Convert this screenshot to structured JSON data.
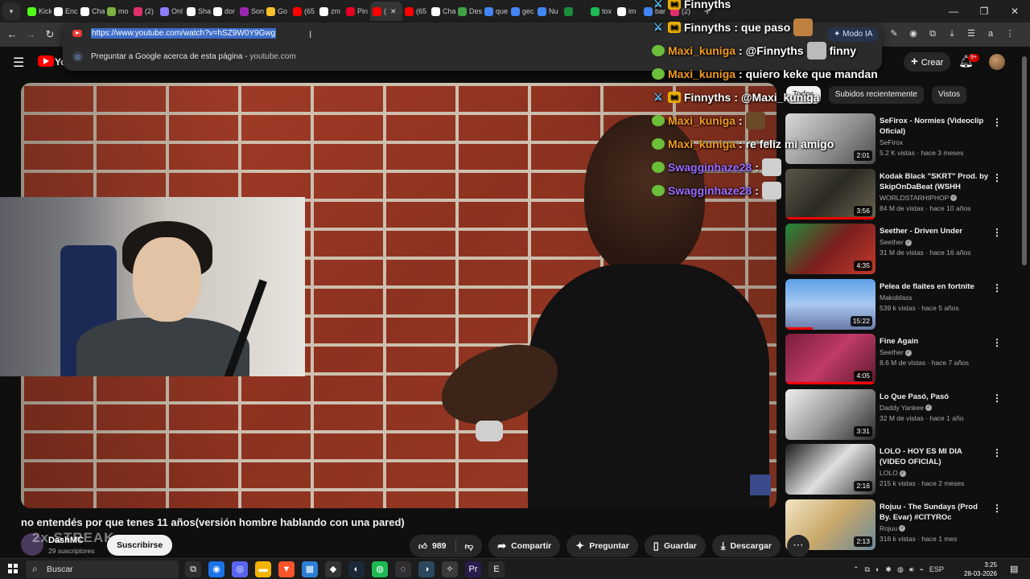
{
  "browser": {
    "tabs": [
      {
        "label": "Kick",
        "color": "#53fc18",
        "active": false
      },
      {
        "label": "Enc",
        "color": "#ffffff",
        "active": false
      },
      {
        "label": "Cha",
        "color": "#ffffff",
        "active": false
      },
      {
        "label": "mo",
        "color": "#7cb342",
        "active": false
      },
      {
        "label": "(2)",
        "color": "#e1306c",
        "active": false
      },
      {
        "label": "Onl",
        "color": "#8c7cff",
        "active": false
      },
      {
        "label": "Sha",
        "color": "#ffffff",
        "active": false
      },
      {
        "label": "dor",
        "color": "#ffffff",
        "active": false
      },
      {
        "label": "Son",
        "color": "#9c27b0",
        "active": false
      },
      {
        "label": "Go",
        "color": "#fbc02d",
        "active": false
      },
      {
        "label": "(65",
        "color": "#ff0000",
        "active": false
      },
      {
        "label": "zm",
        "color": "#ffffff",
        "active": false
      },
      {
        "label": "Pin",
        "color": "#e60023",
        "active": false
      },
      {
        "label": "(",
        "color": "#ff0000",
        "active": true
      },
      {
        "label": "(65",
        "color": "#ff0000",
        "active": false
      },
      {
        "label": "Cha",
        "color": "#ffffff",
        "active": false
      },
      {
        "label": "Des",
        "color": "#43a047",
        "active": false
      },
      {
        "label": "que",
        "color": "#4285f4",
        "active": false
      },
      {
        "label": "gec",
        "color": "#4285f4",
        "active": false
      },
      {
        "label": "Nu",
        "color": "#4285f4",
        "active": false
      },
      {
        "label": "",
        "color": "#1e8e3e",
        "active": false
      },
      {
        "label": "tox",
        "color": "#1db954",
        "active": false
      },
      {
        "label": "im",
        "color": "#ffffff",
        "active": false
      },
      {
        "label": "bar",
        "color": "#4285f4",
        "active": false
      },
      {
        "label": "(2)",
        "color": "#e1306c",
        "active": false
      }
    ],
    "new_tab": "+",
    "window_controls": {
      "minimize": "—",
      "restore": "❐",
      "close": "✕"
    },
    "nav": {
      "back": "←",
      "forward": "→",
      "reload": "↻"
    },
    "url": "https://www.youtube.com/watch?v=hSZ9W0Y9Gwg",
    "suggestion": {
      "text": "Preguntar a Google acerca de esta página",
      "separator": " - ",
      "domain": "youtube.com",
      "icon": "google-lens-icon"
    },
    "modo_ia": "Modo IA",
    "extensions": [
      "✎",
      "◉",
      "⧉",
      "⤓",
      "☰",
      "a",
      "⋮"
    ]
  },
  "youtube": {
    "logo_text": "YouTube",
    "create_label": "Crear",
    "notif_count": "9+",
    "chips": [
      {
        "label": "Todos",
        "active": true
      },
      {
        "label": "Subidos recientemente",
        "active": false
      },
      {
        "label": "Vistos",
        "active": false
      }
    ],
    "video": {
      "title": "no entendés por que tenes 11 años(versión hombre hablando con una pared)",
      "channel": "DashMC",
      "subscribers": "29 suscriptores",
      "subscribe_label": "Suscribirse",
      "likes": "989",
      "share_label": "Compartir",
      "ask_label": "Preguntar",
      "save_label": "Guardar",
      "download_label": "Descargar",
      "more": "⋯"
    },
    "recommendations": [
      {
        "title": "SeFirox - Normies (Videoclip Oficial)",
        "channel": "SeFirox",
        "verified": false,
        "meta": "5.2 K vistas · hace 3 meses",
        "duration": "2:01",
        "progress": 0,
        "thumb": "linear-gradient(135deg,#d9d9d9,#8a8a8a 60%,#4a4a4a)"
      },
      {
        "title": "Kodak Black \"SKRT\" Prod. by SkipOnDaBeat (WSHH Exclusi...",
        "channel": "WORLDSTARHIPHOP",
        "verified": true,
        "meta": "84 M de vistas · hace 10 años",
        "duration": "3:56",
        "progress": 1,
        "thumb": "linear-gradient(135deg,#5a5648,#2b2a24 50%,#6b6552)"
      },
      {
        "title": "Seether - Driven Under",
        "channel": "Seether",
        "verified": true,
        "meta": "31 M de vistas · hace 16 años",
        "duration": "4:35",
        "progress": 0,
        "thumb": "linear-gradient(135deg,#1e8c3a,#7a1e1e 50%,#c23b2a)"
      },
      {
        "title": "Pelea de flaites en fortnite",
        "channel": "Makoblass",
        "verified": false,
        "meta": "539 k vistas · hace 5 años",
        "duration": "15:22",
        "progress": 0.3,
        "thumb": "linear-gradient(180deg,#5ea0e8,#a8c8f0 50%,#6a7aa8)"
      },
      {
        "title": "Fine Again",
        "channel": "Seether",
        "verified": true,
        "meta": "8.6 M de vistas · hace 7 años",
        "duration": "4:05",
        "progress": 1,
        "thumb": "linear-gradient(135deg,#7a1e3a,#c03a6a 50%,#5a1a2a)"
      },
      {
        "title": "Lo Que Pasó, Pasó",
        "channel": "Daddy Yankee",
        "verified": true,
        "meta": "32 M de vistas · hace 1 año",
        "duration": "3:31",
        "progress": 0,
        "thumb": "linear-gradient(135deg,#f0f0f0,#9a9a9a 50%,#2a2a2a)"
      },
      {
        "title": "LOLO - HOY ES MI DIA (VIDEO OFICIAL)",
        "channel": "LOLO",
        "verified": true,
        "meta": "215 k vistas · hace 2 meses",
        "duration": "2:16",
        "progress": 0,
        "thumb": "linear-gradient(135deg,#1a1a1a,#e0e0e0 50%,#3a3a3a)"
      },
      {
        "title": "Rojuu - The Sundays (Prod By. Evar) #CITYROc",
        "channel": "Rojuu",
        "verified": true,
        "meta": "316 k vistas · hace 1 mes",
        "duration": "2:13",
        "progress": 0,
        "thumb": "linear-gradient(135deg,#f3e6c4,#c9a86a 50%,#6a8a9a)"
      }
    ]
  },
  "chat": [
    {
      "user": "Finnyths",
      "badge": "sword",
      "class": "u-f",
      "message": "",
      "emote": ""
    },
    {
      "user": "Finnyths",
      "badge": "sword",
      "class": "u-f",
      "message": ": que paso",
      "emote": "#c08040"
    },
    {
      "user": "Maxi_kuniga",
      "badge": "frog",
      "class": "u-m",
      "message": ": @Finnyths",
      "emote": "#bbbbbb",
      "message2": "finny"
    },
    {
      "user": "Maxi_kuniga",
      "badge": "frog",
      "class": "u-m",
      "message": ": quiero keke que mandan",
      "emote": ""
    },
    {
      "user": "Finnyths",
      "badge": "sword",
      "class": "u-f",
      "message": ": @Maxi_kuniga",
      "emote": ""
    },
    {
      "user": "Maxi_kuniga",
      "badge": "frog",
      "class": "u-m",
      "message": ":",
      "emote": "#6b4a2a"
    },
    {
      "user": "Maxi_kuniga",
      "badge": "frog",
      "class": "u-m",
      "message": ": re feliz mi amigo",
      "emote": ""
    },
    {
      "user": "Swagginhaze28",
      "badge": "frog",
      "class": "u-s",
      "message": ":",
      "emote": "#d0d0d0"
    },
    {
      "user": "Swagginhaze28",
      "badge": "frog",
      "class": "u-s",
      "message": ":",
      "emote": "#d0d0d0"
    }
  ],
  "stream_overlay": {
    "streak": "2x STREAK"
  },
  "taskbar": {
    "search_placeholder": "Buscar",
    "apps": [
      {
        "name": "task-view-icon",
        "glyph": "⧉",
        "color": "#2d2d2d"
      },
      {
        "name": "chrome-icon",
        "glyph": "◉",
        "color": "#1a73e8"
      },
      {
        "name": "discord-icon",
        "glyph": "◎",
        "color": "#5865f2"
      },
      {
        "name": "folder-icon",
        "glyph": "▬",
        "color": "#f2b200"
      },
      {
        "name": "brave-icon",
        "glyph": "▼",
        "color": "#fb542b"
      },
      {
        "name": "store-icon",
        "glyph": "▦",
        "color": "#2d7fd6"
      },
      {
        "name": "epic-icon",
        "glyph": "◆",
        "color": "#333333"
      },
      {
        "name": "steam-icon",
        "glyph": "◐",
        "color": "#1b2838"
      },
      {
        "name": "spotify-icon",
        "glyph": "◍",
        "color": "#1db954"
      },
      {
        "name": "obs-icon",
        "glyph": "◌",
        "color": "#302e31"
      },
      {
        "name": "steam-alt-icon",
        "glyph": "◑",
        "color": "#2a475e"
      },
      {
        "name": "app-icon",
        "glyph": "✧",
        "color": "#3a3a3a"
      },
      {
        "name": "premiere-icon",
        "glyph": "Pr",
        "color": "#2a1b4d"
      },
      {
        "name": "epic-games-icon",
        "glyph": "E",
        "color": "#2b2b2b"
      }
    ],
    "language": "ESP",
    "time": "3:25",
    "date": "28-03-2026"
  }
}
